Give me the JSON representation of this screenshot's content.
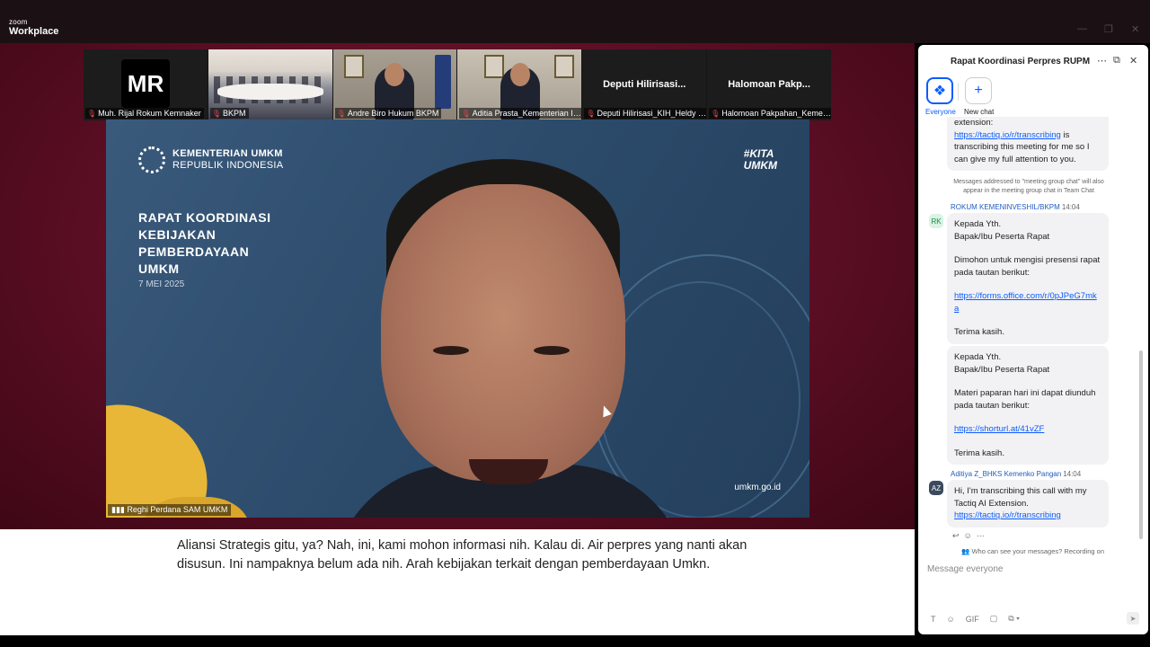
{
  "app": {
    "brand_small": "zoom",
    "brand_big": "Workplace"
  },
  "participants": [
    {
      "name": "Muh. Rijal Rokum Kemnaker",
      "initials": "MR",
      "muted": true
    },
    {
      "name": "BKPM",
      "muted": true
    },
    {
      "name": "Andre Biro Hukum BKPM",
      "muted": true
    },
    {
      "name": "Aditia Prasta_Kementerian Inv...",
      "muted": true
    },
    {
      "name": "Deputi Hilirisasi_KIH_Heldy Pu...",
      "display": "Deputi  Hilirisasi...",
      "muted": true
    },
    {
      "name": "Halomoan Pakpahan_Kemend...",
      "display": "Halomoan  Pakp...",
      "muted": true
    }
  ],
  "main_video": {
    "speaker_name": "Reghi Perdana SAM UMKM",
    "slide": {
      "org_line1": "KEMENTERIAN UMKM",
      "org_line2": "REPUBLIK INDONESIA",
      "tag_line1": "#KITA",
      "tag_line2": "UMKM",
      "title_line1": "RAPAT KOORDINASI",
      "title_line2": "KEBIJAKAN",
      "title_line3": "PEMBERDAYAAN",
      "title_line4": "UMKM",
      "date": "7 MEI 2025",
      "url": "umkm.go.id"
    }
  },
  "caption": {
    "text": "Aliansi Strategis gitu, ya? Nah, ini, kami mohon informasi nih. Kalau di. Air perpres yang nanti akan disusun. Ini nampaknya belum ada nih. Arah kebijakan terkait dengan pemberdayaan Umkn."
  },
  "chat": {
    "title": "Rapat Koordinasi Perpres RUPM",
    "tabs": {
      "everyone": "Everyone",
      "new_chat": "New chat"
    },
    "first_msg": {
      "line": "extension:",
      "link": "https://tactiq.io/r/transcribing",
      "rest": " is transcribing this meeting for me so I can give my full attention to you."
    },
    "notice": "Messages addressed to \"meeting group chat\" will also appear in the meeting group chat in Team Chat",
    "msg2": {
      "sender": "ROKUM KEMENINVESHIL/BKPM",
      "time": "14:04",
      "initials": "RK",
      "l1": "Kepada Yth.",
      "l2": "Bapak/Ibu Peserta Rapat",
      "l3": "Dimohon untuk mengisi presensi rapat pada tautan berikut:",
      "link": "https://forms.office.com/r/0pJPeG7mka",
      "l4": "Terima kasih."
    },
    "msg3": {
      "l1": "Kepada Yth.",
      "l2": "Bapak/Ibu Peserta Rapat",
      "l3": "Materi paparan hari ini dapat diunduh pada tautan berikut:",
      "link": "https://shorturl.at/41vZF",
      "l4": "Terima kasih."
    },
    "msg4": {
      "sender": "Aditiya Z_BHKS Kemenko Pangan",
      "time": "14:04",
      "initials": "AZ",
      "text": "Hi, I'm transcribing this call with my Tactiq AI Extension.",
      "link": "https://tactiq.io/r/transcribing"
    },
    "who_can_see": "Who can see your messages? Recording on",
    "input_placeholder": "Message everyone"
  },
  "colors": {
    "accent": "#0b5cff",
    "stage": "#5b0e24",
    "mute": "#e5484d"
  }
}
